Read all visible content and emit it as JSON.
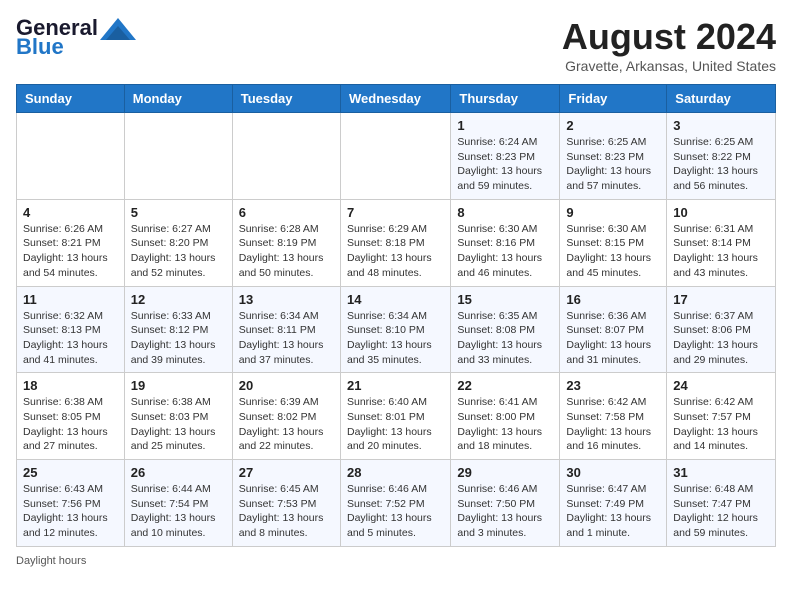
{
  "header": {
    "logo_line1": "General",
    "logo_line2": "Blue",
    "month": "August 2024",
    "location": "Gravette, Arkansas, United States"
  },
  "days_of_week": [
    "Sunday",
    "Monday",
    "Tuesday",
    "Wednesday",
    "Thursday",
    "Friday",
    "Saturday"
  ],
  "weeks": [
    [
      {
        "day": "",
        "info": ""
      },
      {
        "day": "",
        "info": ""
      },
      {
        "day": "",
        "info": ""
      },
      {
        "day": "",
        "info": ""
      },
      {
        "day": "1",
        "info": "Sunrise: 6:24 AM\nSunset: 8:23 PM\nDaylight: 13 hours\nand 59 minutes."
      },
      {
        "day": "2",
        "info": "Sunrise: 6:25 AM\nSunset: 8:23 PM\nDaylight: 13 hours\nand 57 minutes."
      },
      {
        "day": "3",
        "info": "Sunrise: 6:25 AM\nSunset: 8:22 PM\nDaylight: 13 hours\nand 56 minutes."
      }
    ],
    [
      {
        "day": "4",
        "info": "Sunrise: 6:26 AM\nSunset: 8:21 PM\nDaylight: 13 hours\nand 54 minutes."
      },
      {
        "day": "5",
        "info": "Sunrise: 6:27 AM\nSunset: 8:20 PM\nDaylight: 13 hours\nand 52 minutes."
      },
      {
        "day": "6",
        "info": "Sunrise: 6:28 AM\nSunset: 8:19 PM\nDaylight: 13 hours\nand 50 minutes."
      },
      {
        "day": "7",
        "info": "Sunrise: 6:29 AM\nSunset: 8:18 PM\nDaylight: 13 hours\nand 48 minutes."
      },
      {
        "day": "8",
        "info": "Sunrise: 6:30 AM\nSunset: 8:16 PM\nDaylight: 13 hours\nand 46 minutes."
      },
      {
        "day": "9",
        "info": "Sunrise: 6:30 AM\nSunset: 8:15 PM\nDaylight: 13 hours\nand 45 minutes."
      },
      {
        "day": "10",
        "info": "Sunrise: 6:31 AM\nSunset: 8:14 PM\nDaylight: 13 hours\nand 43 minutes."
      }
    ],
    [
      {
        "day": "11",
        "info": "Sunrise: 6:32 AM\nSunset: 8:13 PM\nDaylight: 13 hours\nand 41 minutes."
      },
      {
        "day": "12",
        "info": "Sunrise: 6:33 AM\nSunset: 8:12 PM\nDaylight: 13 hours\nand 39 minutes."
      },
      {
        "day": "13",
        "info": "Sunrise: 6:34 AM\nSunset: 8:11 PM\nDaylight: 13 hours\nand 37 minutes."
      },
      {
        "day": "14",
        "info": "Sunrise: 6:34 AM\nSunset: 8:10 PM\nDaylight: 13 hours\nand 35 minutes."
      },
      {
        "day": "15",
        "info": "Sunrise: 6:35 AM\nSunset: 8:08 PM\nDaylight: 13 hours\nand 33 minutes."
      },
      {
        "day": "16",
        "info": "Sunrise: 6:36 AM\nSunset: 8:07 PM\nDaylight: 13 hours\nand 31 minutes."
      },
      {
        "day": "17",
        "info": "Sunrise: 6:37 AM\nSunset: 8:06 PM\nDaylight: 13 hours\nand 29 minutes."
      }
    ],
    [
      {
        "day": "18",
        "info": "Sunrise: 6:38 AM\nSunset: 8:05 PM\nDaylight: 13 hours\nand 27 minutes."
      },
      {
        "day": "19",
        "info": "Sunrise: 6:38 AM\nSunset: 8:03 PM\nDaylight: 13 hours\nand 25 minutes."
      },
      {
        "day": "20",
        "info": "Sunrise: 6:39 AM\nSunset: 8:02 PM\nDaylight: 13 hours\nand 22 minutes."
      },
      {
        "day": "21",
        "info": "Sunrise: 6:40 AM\nSunset: 8:01 PM\nDaylight: 13 hours\nand 20 minutes."
      },
      {
        "day": "22",
        "info": "Sunrise: 6:41 AM\nSunset: 8:00 PM\nDaylight: 13 hours\nand 18 minutes."
      },
      {
        "day": "23",
        "info": "Sunrise: 6:42 AM\nSunset: 7:58 PM\nDaylight: 13 hours\nand 16 minutes."
      },
      {
        "day": "24",
        "info": "Sunrise: 6:42 AM\nSunset: 7:57 PM\nDaylight: 13 hours\nand 14 minutes."
      }
    ],
    [
      {
        "day": "25",
        "info": "Sunrise: 6:43 AM\nSunset: 7:56 PM\nDaylight: 13 hours\nand 12 minutes."
      },
      {
        "day": "26",
        "info": "Sunrise: 6:44 AM\nSunset: 7:54 PM\nDaylight: 13 hours\nand 10 minutes."
      },
      {
        "day": "27",
        "info": "Sunrise: 6:45 AM\nSunset: 7:53 PM\nDaylight: 13 hours\nand 8 minutes."
      },
      {
        "day": "28",
        "info": "Sunrise: 6:46 AM\nSunset: 7:52 PM\nDaylight: 13 hours\nand 5 minutes."
      },
      {
        "day": "29",
        "info": "Sunrise: 6:46 AM\nSunset: 7:50 PM\nDaylight: 13 hours\nand 3 minutes."
      },
      {
        "day": "30",
        "info": "Sunrise: 6:47 AM\nSunset: 7:49 PM\nDaylight: 13 hours\nand 1 minute."
      },
      {
        "day": "31",
        "info": "Sunrise: 6:48 AM\nSunset: 7:47 PM\nDaylight: 12 hours\nand 59 minutes."
      }
    ]
  ],
  "footer": {
    "note": "Daylight hours"
  }
}
